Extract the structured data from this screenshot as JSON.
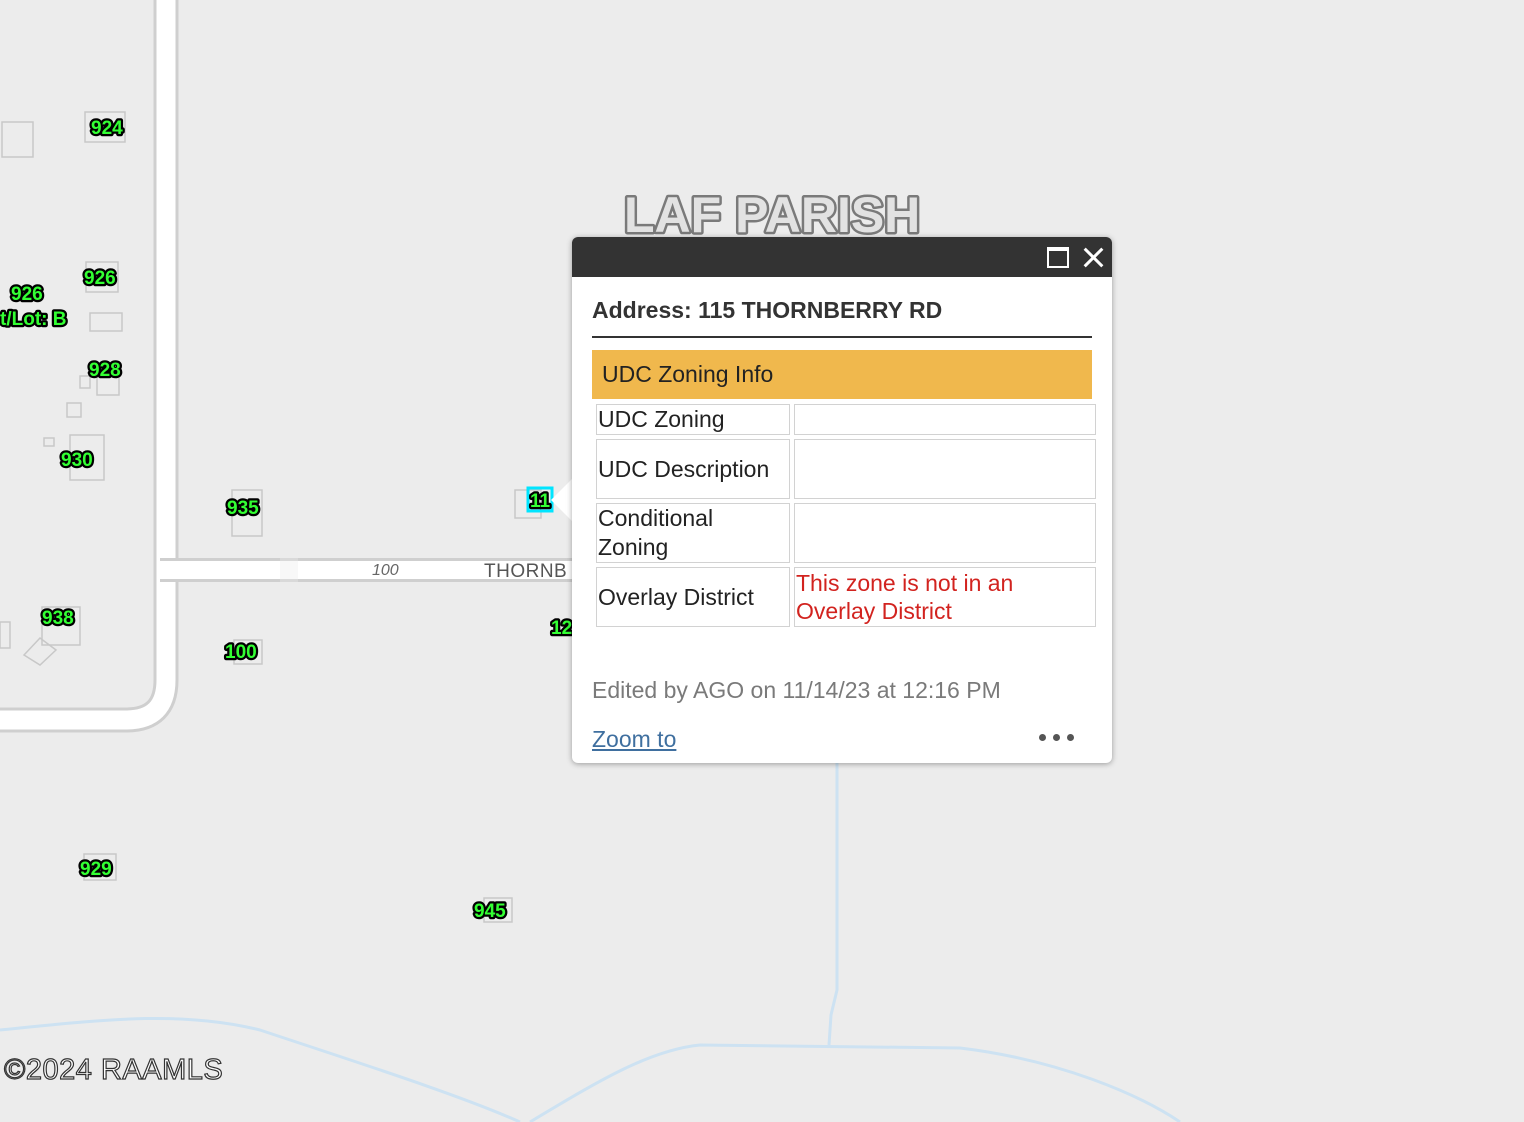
{
  "map": {
    "parish_label": "LAF PARISH",
    "road_name": "THORNB",
    "road_number": "100",
    "copyright": "©2024 RAAMLS",
    "address_labels": [
      "924",
      "926",
      "926",
      "t/Lot: B",
      "928",
      "930",
      "935",
      "938",
      "100",
      "929",
      "945",
      "11",
      "12"
    ]
  },
  "popup": {
    "title": "Address: 115 THORNBERRY RD",
    "section_header": "UDC Zoning Info",
    "rows": [
      {
        "label": "UDC Zoning",
        "value": ""
      },
      {
        "label": "UDC Description",
        "value": ""
      },
      {
        "label": "Conditional Zoning",
        "value": ""
      },
      {
        "label": "Overlay District",
        "value": "This zone is not in an Overlay District"
      }
    ],
    "edit_info": "Edited by AGO on 11/14/23 at 12:16 PM",
    "zoom_label": "Zoom to",
    "colors": {
      "header": "#333333",
      "section": "#f0b84d",
      "value_text": "#d2231f",
      "link": "#3f6f9f"
    }
  },
  "icons": [
    "maximize-icon",
    "close-icon",
    "more-options-icon"
  ]
}
